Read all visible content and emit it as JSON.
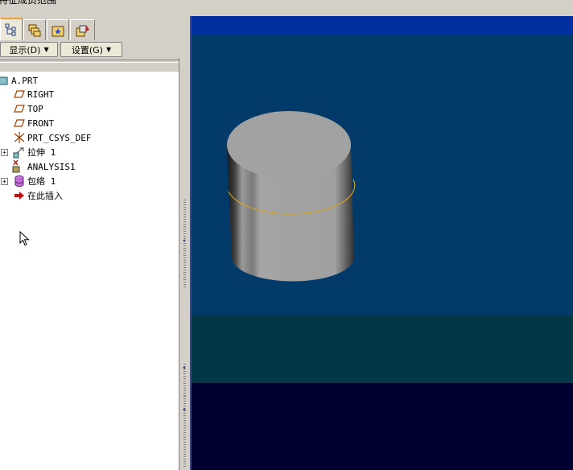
{
  "app": {
    "title_fragment": "特征成员范围"
  },
  "tabs": [
    {
      "icon": "model-tree-icon"
    },
    {
      "icon": "layers-icon"
    },
    {
      "icon": "favorites-icon"
    },
    {
      "icon": "web-browser-icon"
    }
  ],
  "toolbar": {
    "display_label": "显示(D)",
    "settings_label": "设置(G)"
  },
  "model_tree": {
    "items": [
      {
        "label": "A.PRT",
        "icon": "part-icon",
        "expandable": false
      },
      {
        "label": "RIGHT",
        "icon": "datum-plane-icon",
        "expandable": false
      },
      {
        "label": "TOP",
        "icon": "datum-plane-icon",
        "expandable": false
      },
      {
        "label": "FRONT",
        "icon": "datum-plane-icon",
        "expandable": false
      },
      {
        "label": "PRT_CSYS_DEF",
        "icon": "coordinate-system-icon",
        "expandable": false
      },
      {
        "label": "拉伸 1",
        "icon": "extrude-icon",
        "expandable": true
      },
      {
        "label": "ANALYSIS1",
        "icon": "analysis-icon",
        "expandable": false
      },
      {
        "label": "包络 1",
        "icon": "envelope-icon",
        "expandable": true
      },
      {
        "label": "在此插入",
        "icon": "insert-here-arrow-icon",
        "expandable": false
      }
    ]
  },
  "viewport": {
    "background": "#023a6a",
    "model": "cylinder",
    "curve_color": "#d4a020"
  }
}
